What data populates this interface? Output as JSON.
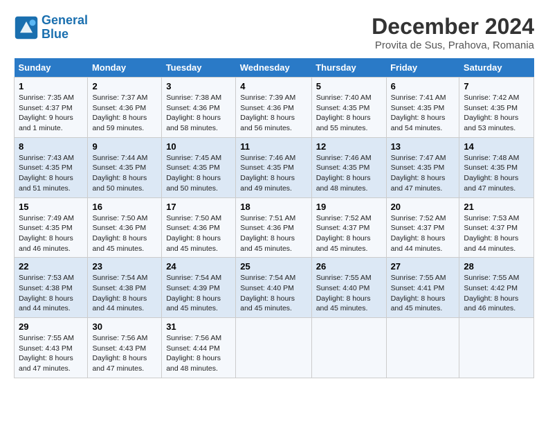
{
  "header": {
    "logo_line1": "General",
    "logo_line2": "Blue",
    "title": "December 2024",
    "subtitle": "Provita de Sus, Prahova, Romania"
  },
  "columns": [
    "Sunday",
    "Monday",
    "Tuesday",
    "Wednesday",
    "Thursday",
    "Friday",
    "Saturday"
  ],
  "weeks": [
    [
      {
        "day": "1",
        "sunrise": "Sunrise: 7:35 AM",
        "sunset": "Sunset: 4:37 PM",
        "daylight": "Daylight: 9 hours and 1 minute."
      },
      {
        "day": "2",
        "sunrise": "Sunrise: 7:37 AM",
        "sunset": "Sunset: 4:36 PM",
        "daylight": "Daylight: 8 hours and 59 minutes."
      },
      {
        "day": "3",
        "sunrise": "Sunrise: 7:38 AM",
        "sunset": "Sunset: 4:36 PM",
        "daylight": "Daylight: 8 hours and 58 minutes."
      },
      {
        "day": "4",
        "sunrise": "Sunrise: 7:39 AM",
        "sunset": "Sunset: 4:36 PM",
        "daylight": "Daylight: 8 hours and 56 minutes."
      },
      {
        "day": "5",
        "sunrise": "Sunrise: 7:40 AM",
        "sunset": "Sunset: 4:35 PM",
        "daylight": "Daylight: 8 hours and 55 minutes."
      },
      {
        "day": "6",
        "sunrise": "Sunrise: 7:41 AM",
        "sunset": "Sunset: 4:35 PM",
        "daylight": "Daylight: 8 hours and 54 minutes."
      },
      {
        "day": "7",
        "sunrise": "Sunrise: 7:42 AM",
        "sunset": "Sunset: 4:35 PM",
        "daylight": "Daylight: 8 hours and 53 minutes."
      }
    ],
    [
      {
        "day": "8",
        "sunrise": "Sunrise: 7:43 AM",
        "sunset": "Sunset: 4:35 PM",
        "daylight": "Daylight: 8 hours and 51 minutes."
      },
      {
        "day": "9",
        "sunrise": "Sunrise: 7:44 AM",
        "sunset": "Sunset: 4:35 PM",
        "daylight": "Daylight: 8 hours and 50 minutes."
      },
      {
        "day": "10",
        "sunrise": "Sunrise: 7:45 AM",
        "sunset": "Sunset: 4:35 PM",
        "daylight": "Daylight: 8 hours and 50 minutes."
      },
      {
        "day": "11",
        "sunrise": "Sunrise: 7:46 AM",
        "sunset": "Sunset: 4:35 PM",
        "daylight": "Daylight: 8 hours and 49 minutes."
      },
      {
        "day": "12",
        "sunrise": "Sunrise: 7:46 AM",
        "sunset": "Sunset: 4:35 PM",
        "daylight": "Daylight: 8 hours and 48 minutes."
      },
      {
        "day": "13",
        "sunrise": "Sunrise: 7:47 AM",
        "sunset": "Sunset: 4:35 PM",
        "daylight": "Daylight: 8 hours and 47 minutes."
      },
      {
        "day": "14",
        "sunrise": "Sunrise: 7:48 AM",
        "sunset": "Sunset: 4:35 PM",
        "daylight": "Daylight: 8 hours and 47 minutes."
      }
    ],
    [
      {
        "day": "15",
        "sunrise": "Sunrise: 7:49 AM",
        "sunset": "Sunset: 4:35 PM",
        "daylight": "Daylight: 8 hours and 46 minutes."
      },
      {
        "day": "16",
        "sunrise": "Sunrise: 7:50 AM",
        "sunset": "Sunset: 4:36 PM",
        "daylight": "Daylight: 8 hours and 45 minutes."
      },
      {
        "day": "17",
        "sunrise": "Sunrise: 7:50 AM",
        "sunset": "Sunset: 4:36 PM",
        "daylight": "Daylight: 8 hours and 45 minutes."
      },
      {
        "day": "18",
        "sunrise": "Sunrise: 7:51 AM",
        "sunset": "Sunset: 4:36 PM",
        "daylight": "Daylight: 8 hours and 45 minutes."
      },
      {
        "day": "19",
        "sunrise": "Sunrise: 7:52 AM",
        "sunset": "Sunset: 4:37 PM",
        "daylight": "Daylight: 8 hours and 45 minutes."
      },
      {
        "day": "20",
        "sunrise": "Sunrise: 7:52 AM",
        "sunset": "Sunset: 4:37 PM",
        "daylight": "Daylight: 8 hours and 44 minutes."
      },
      {
        "day": "21",
        "sunrise": "Sunrise: 7:53 AM",
        "sunset": "Sunset: 4:37 PM",
        "daylight": "Daylight: 8 hours and 44 minutes."
      }
    ],
    [
      {
        "day": "22",
        "sunrise": "Sunrise: 7:53 AM",
        "sunset": "Sunset: 4:38 PM",
        "daylight": "Daylight: 8 hours and 44 minutes."
      },
      {
        "day": "23",
        "sunrise": "Sunrise: 7:54 AM",
        "sunset": "Sunset: 4:38 PM",
        "daylight": "Daylight: 8 hours and 44 minutes."
      },
      {
        "day": "24",
        "sunrise": "Sunrise: 7:54 AM",
        "sunset": "Sunset: 4:39 PM",
        "daylight": "Daylight: 8 hours and 45 minutes."
      },
      {
        "day": "25",
        "sunrise": "Sunrise: 7:54 AM",
        "sunset": "Sunset: 4:40 PM",
        "daylight": "Daylight: 8 hours and 45 minutes."
      },
      {
        "day": "26",
        "sunrise": "Sunrise: 7:55 AM",
        "sunset": "Sunset: 4:40 PM",
        "daylight": "Daylight: 8 hours and 45 minutes."
      },
      {
        "day": "27",
        "sunrise": "Sunrise: 7:55 AM",
        "sunset": "Sunset: 4:41 PM",
        "daylight": "Daylight: 8 hours and 45 minutes."
      },
      {
        "day": "28",
        "sunrise": "Sunrise: 7:55 AM",
        "sunset": "Sunset: 4:42 PM",
        "daylight": "Daylight: 8 hours and 46 minutes."
      }
    ],
    [
      {
        "day": "29",
        "sunrise": "Sunrise: 7:55 AM",
        "sunset": "Sunset: 4:43 PM",
        "daylight": "Daylight: 8 hours and 47 minutes."
      },
      {
        "day": "30",
        "sunrise": "Sunrise: 7:56 AM",
        "sunset": "Sunset: 4:43 PM",
        "daylight": "Daylight: 8 hours and 47 minutes."
      },
      {
        "day": "31",
        "sunrise": "Sunrise: 7:56 AM",
        "sunset": "Sunset: 4:44 PM",
        "daylight": "Daylight: 8 hours and 48 minutes."
      },
      null,
      null,
      null,
      null
    ]
  ]
}
